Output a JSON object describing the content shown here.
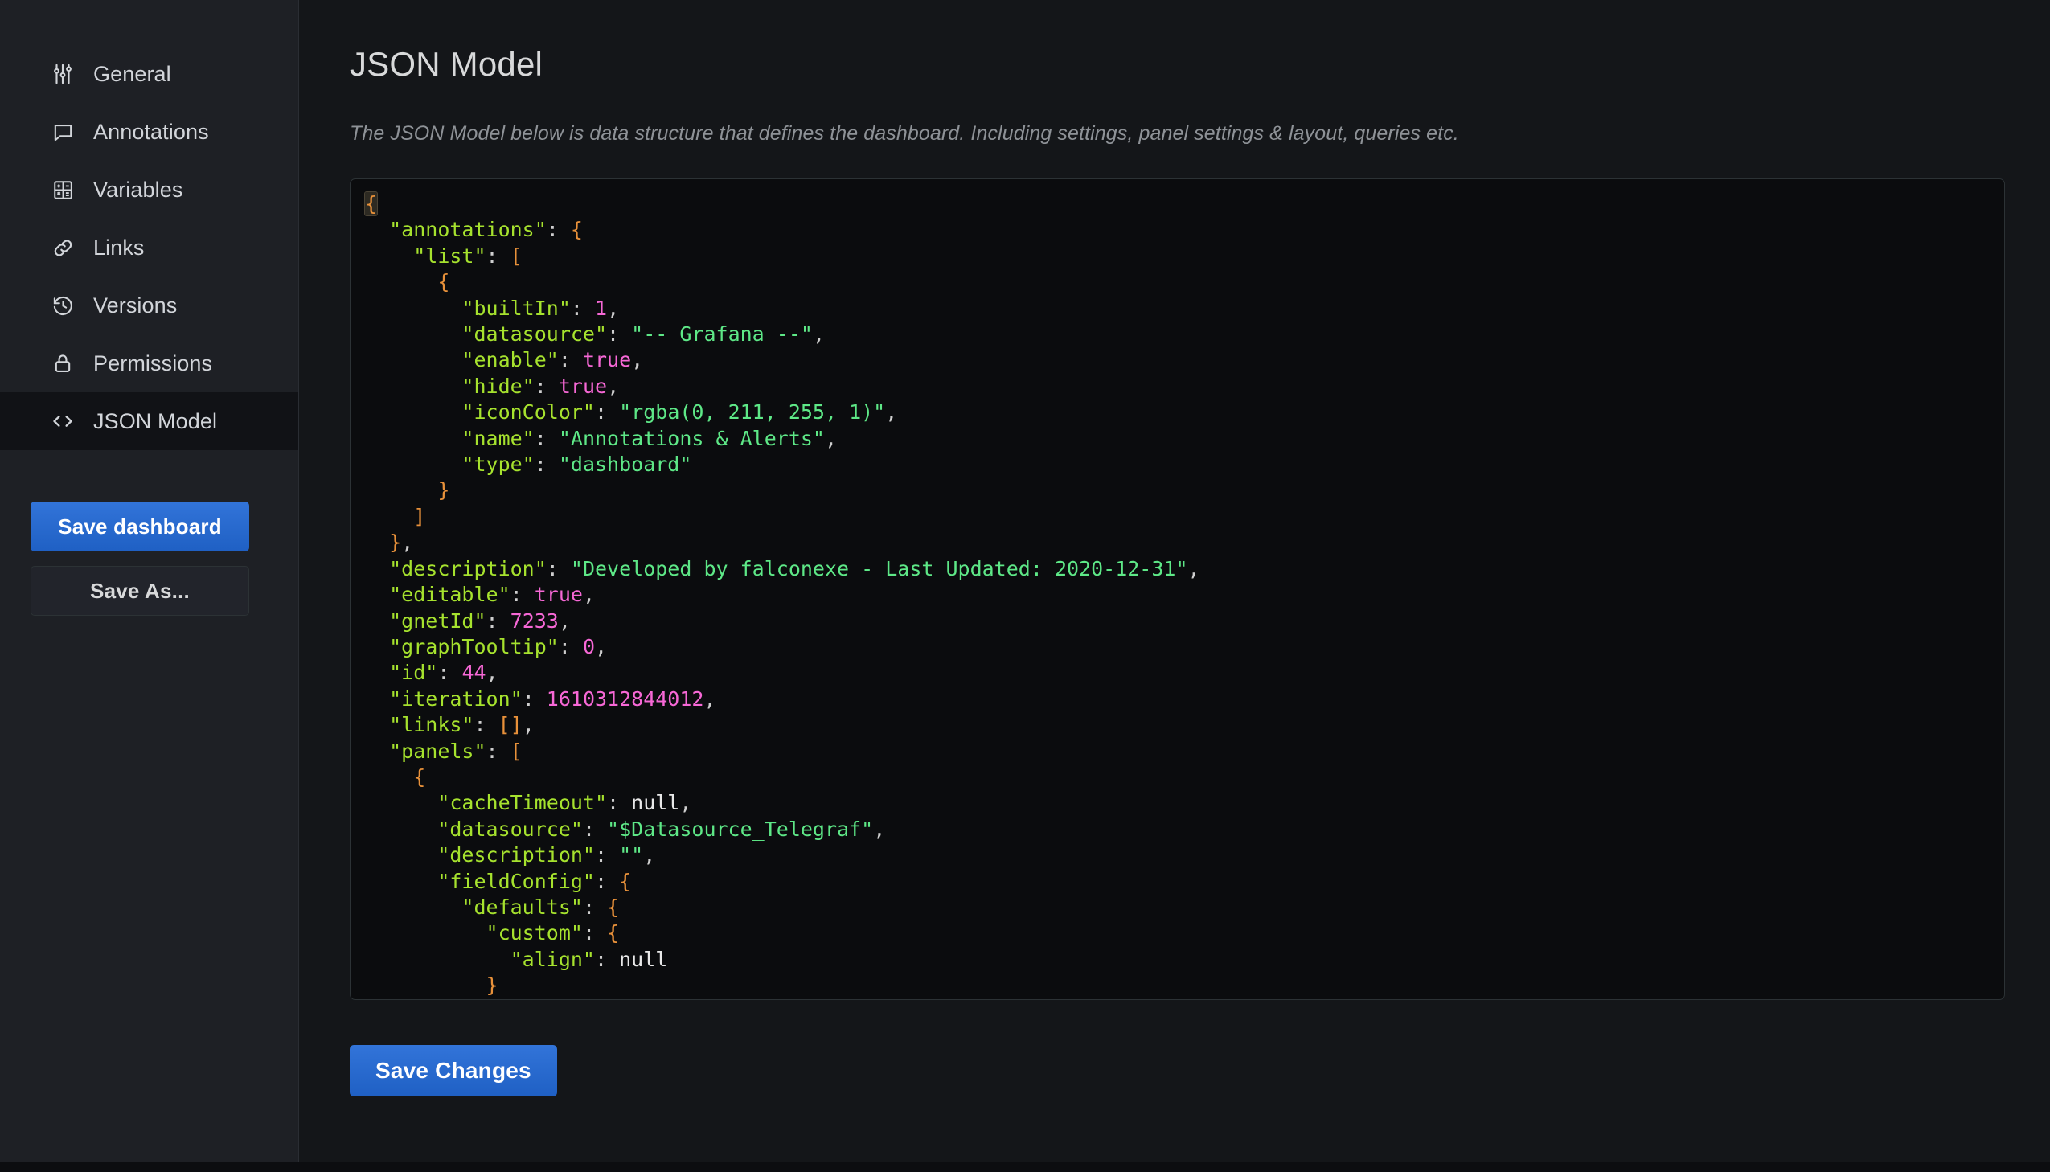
{
  "sidebar": {
    "items": [
      {
        "label": "General",
        "icon": "sliders-icon",
        "active": false
      },
      {
        "label": "Annotations",
        "icon": "comment-icon",
        "active": false
      },
      {
        "label": "Variables",
        "icon": "calculator-icon",
        "active": false
      },
      {
        "label": "Links",
        "icon": "link-icon",
        "active": false
      },
      {
        "label": "Versions",
        "icon": "history-icon",
        "active": false
      },
      {
        "label": "Permissions",
        "icon": "lock-icon",
        "active": false
      },
      {
        "label": "JSON Model",
        "icon": "code-icon",
        "active": true
      }
    ],
    "save_dashboard_label": "Save dashboard",
    "save_as_label": "Save As..."
  },
  "main": {
    "title": "JSON Model",
    "description": "The JSON Model below is data structure that defines the dashboard. Including settings, panel settings & layout, queries etc.",
    "save_changes_label": "Save Changes"
  },
  "editor": {
    "lines": [
      {
        "indent": 0,
        "tokens": [
          {
            "t": "brace-hl",
            "v": "{"
          }
        ]
      },
      {
        "indent": 1,
        "tokens": [
          {
            "t": "key",
            "v": "\"annotations\""
          },
          {
            "t": "punc",
            "v": ": "
          },
          {
            "t": "brace",
            "v": "{"
          }
        ]
      },
      {
        "indent": 2,
        "tokens": [
          {
            "t": "key",
            "v": "\"list\""
          },
          {
            "t": "punc",
            "v": ": "
          },
          {
            "t": "brace",
            "v": "["
          }
        ]
      },
      {
        "indent": 3,
        "tokens": [
          {
            "t": "brace",
            "v": "{"
          }
        ]
      },
      {
        "indent": 4,
        "tokens": [
          {
            "t": "key",
            "v": "\"builtIn\""
          },
          {
            "t": "punc",
            "v": ": "
          },
          {
            "t": "num",
            "v": "1"
          },
          {
            "t": "punc",
            "v": ","
          }
        ]
      },
      {
        "indent": 4,
        "tokens": [
          {
            "t": "key",
            "v": "\"datasource\""
          },
          {
            "t": "punc",
            "v": ": "
          },
          {
            "t": "str",
            "v": "\"-- Grafana --\""
          },
          {
            "t": "punc",
            "v": ","
          }
        ]
      },
      {
        "indent": 4,
        "tokens": [
          {
            "t": "key",
            "v": "\"enable\""
          },
          {
            "t": "punc",
            "v": ": "
          },
          {
            "t": "bool",
            "v": "true"
          },
          {
            "t": "punc",
            "v": ","
          }
        ]
      },
      {
        "indent": 4,
        "tokens": [
          {
            "t": "key",
            "v": "\"hide\""
          },
          {
            "t": "punc",
            "v": ": "
          },
          {
            "t": "bool",
            "v": "true"
          },
          {
            "t": "punc",
            "v": ","
          }
        ]
      },
      {
        "indent": 4,
        "tokens": [
          {
            "t": "key",
            "v": "\"iconColor\""
          },
          {
            "t": "punc",
            "v": ": "
          },
          {
            "t": "str",
            "v": "\"rgba(0, 211, 255, 1)\""
          },
          {
            "t": "punc",
            "v": ","
          }
        ]
      },
      {
        "indent": 4,
        "tokens": [
          {
            "t": "key",
            "v": "\"name\""
          },
          {
            "t": "punc",
            "v": ": "
          },
          {
            "t": "str",
            "v": "\"Annotations & Alerts\""
          },
          {
            "t": "punc",
            "v": ","
          }
        ]
      },
      {
        "indent": 4,
        "tokens": [
          {
            "t": "key",
            "v": "\"type\""
          },
          {
            "t": "punc",
            "v": ": "
          },
          {
            "t": "str",
            "v": "\"dashboard\""
          }
        ]
      },
      {
        "indent": 3,
        "tokens": [
          {
            "t": "brace",
            "v": "}"
          }
        ]
      },
      {
        "indent": 2,
        "tokens": [
          {
            "t": "brace",
            "v": "]"
          }
        ]
      },
      {
        "indent": 1,
        "tokens": [
          {
            "t": "brace",
            "v": "}"
          },
          {
            "t": "punc",
            "v": ","
          }
        ]
      },
      {
        "indent": 1,
        "tokens": [
          {
            "t": "key",
            "v": "\"description\""
          },
          {
            "t": "punc",
            "v": ": "
          },
          {
            "t": "str",
            "v": "\"Developed by falconexe - Last Updated: 2020-12-31\""
          },
          {
            "t": "punc",
            "v": ","
          }
        ]
      },
      {
        "indent": 1,
        "tokens": [
          {
            "t": "key",
            "v": "\"editable\""
          },
          {
            "t": "punc",
            "v": ": "
          },
          {
            "t": "bool",
            "v": "true"
          },
          {
            "t": "punc",
            "v": ","
          }
        ]
      },
      {
        "indent": 1,
        "tokens": [
          {
            "t": "key",
            "v": "\"gnetId\""
          },
          {
            "t": "punc",
            "v": ": "
          },
          {
            "t": "num",
            "v": "7233"
          },
          {
            "t": "punc",
            "v": ","
          }
        ]
      },
      {
        "indent": 1,
        "tokens": [
          {
            "t": "key",
            "v": "\"graphTooltip\""
          },
          {
            "t": "punc",
            "v": ": "
          },
          {
            "t": "num",
            "v": "0"
          },
          {
            "t": "punc",
            "v": ","
          }
        ]
      },
      {
        "indent": 1,
        "tokens": [
          {
            "t": "key",
            "v": "\"id\""
          },
          {
            "t": "punc",
            "v": ": "
          },
          {
            "t": "num",
            "v": "44"
          },
          {
            "t": "punc",
            "v": ","
          }
        ]
      },
      {
        "indent": 1,
        "tokens": [
          {
            "t": "key",
            "v": "\"iteration\""
          },
          {
            "t": "punc",
            "v": ": "
          },
          {
            "t": "num",
            "v": "1610312844012"
          },
          {
            "t": "punc",
            "v": ","
          }
        ]
      },
      {
        "indent": 1,
        "tokens": [
          {
            "t": "key",
            "v": "\"links\""
          },
          {
            "t": "punc",
            "v": ": "
          },
          {
            "t": "brace",
            "v": "[]"
          },
          {
            "t": "punc",
            "v": ","
          }
        ]
      },
      {
        "indent": 1,
        "tokens": [
          {
            "t": "key",
            "v": "\"panels\""
          },
          {
            "t": "punc",
            "v": ": "
          },
          {
            "t": "brace",
            "v": "["
          }
        ]
      },
      {
        "indent": 2,
        "tokens": [
          {
            "t": "brace",
            "v": "{"
          }
        ]
      },
      {
        "indent": 3,
        "tokens": [
          {
            "t": "key",
            "v": "\"cacheTimeout\""
          },
          {
            "t": "punc",
            "v": ": "
          },
          {
            "t": "null",
            "v": "null"
          },
          {
            "t": "punc",
            "v": ","
          }
        ]
      },
      {
        "indent": 3,
        "tokens": [
          {
            "t": "key",
            "v": "\"datasource\""
          },
          {
            "t": "punc",
            "v": ": "
          },
          {
            "t": "str",
            "v": "\"$Datasource_Telegraf\""
          },
          {
            "t": "punc",
            "v": ","
          }
        ]
      },
      {
        "indent": 3,
        "tokens": [
          {
            "t": "key",
            "v": "\"description\""
          },
          {
            "t": "punc",
            "v": ": "
          },
          {
            "t": "str",
            "v": "\"\""
          },
          {
            "t": "punc",
            "v": ","
          }
        ]
      },
      {
        "indent": 3,
        "tokens": [
          {
            "t": "key",
            "v": "\"fieldConfig\""
          },
          {
            "t": "punc",
            "v": ": "
          },
          {
            "t": "brace",
            "v": "{"
          }
        ]
      },
      {
        "indent": 4,
        "tokens": [
          {
            "t": "key",
            "v": "\"defaults\""
          },
          {
            "t": "punc",
            "v": ": "
          },
          {
            "t": "brace",
            "v": "{"
          }
        ]
      },
      {
        "indent": 5,
        "tokens": [
          {
            "t": "key",
            "v": "\"custom\""
          },
          {
            "t": "punc",
            "v": ": "
          },
          {
            "t": "brace",
            "v": "{"
          }
        ]
      },
      {
        "indent": 6,
        "tokens": [
          {
            "t": "key",
            "v": "\"align\""
          },
          {
            "t": "punc",
            "v": ": "
          },
          {
            "t": "null",
            "v": "null"
          }
        ]
      },
      {
        "indent": 5,
        "tokens": [
          {
            "t": "brace",
            "v": "}"
          }
        ]
      }
    ]
  }
}
